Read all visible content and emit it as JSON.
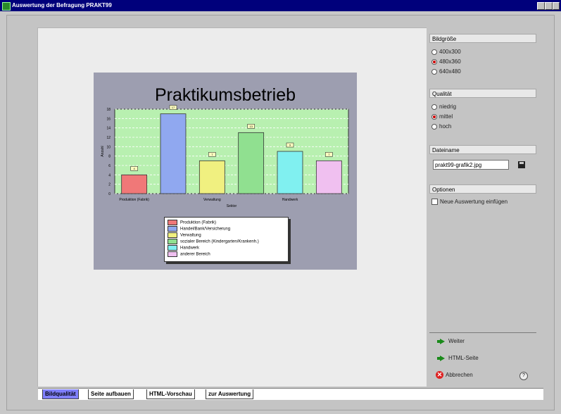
{
  "window": {
    "title": "Auswertung der Befragung   PRAKT99"
  },
  "chart": {
    "title": "Praktikumsbetrieb",
    "ylabel": "Anzahl",
    "xlabel": "Sektor",
    "xtick_labels": [
      "Produktion (Fabrik)",
      "Verwaltung",
      "Handwerk"
    ],
    "y_ticks": [
      "0",
      "2",
      "4",
      "6",
      "8",
      "10",
      "12",
      "14",
      "16",
      "18"
    ],
    "legend": [
      "Produktion (Fabrik)",
      "Handel/Bank/Versicherung",
      "Verwaltung",
      "sozialer Bereich (Kindergarten/Krankenh.)",
      "Handwerk",
      "anderer Bereich"
    ]
  },
  "chart_data": {
    "type": "bar",
    "title": "Praktikumsbetrieb",
    "categories": [
      "Produktion (Fabrik)",
      "Handel/Bank/Versicherung",
      "Verwaltung",
      "sozialer Bereich (Kindergarten/Krankenh.)",
      "Handwerk",
      "anderer Bereich"
    ],
    "values": [
      4,
      17,
      7,
      13,
      9,
      7
    ],
    "ylim": [
      0,
      18
    ],
    "grid": true,
    "legend_position": "bottom",
    "colors": [
      "#f07878",
      "#90a8f0",
      "#f0f080",
      "#90e090",
      "#80f0f0",
      "#f0c0f0"
    ]
  },
  "panel": {
    "size_section": {
      "header": "Bildgröße",
      "options": [
        "400x300",
        "480x360",
        "640x480"
      ],
      "selected": 1
    },
    "quality_section": {
      "header": "Qualität",
      "options": [
        "niedrig",
        "mittel",
        "hoch"
      ],
      "selected": 1
    },
    "filename_section": {
      "header": "Dateiname",
      "value": "prakt99-grafik2.jpg"
    },
    "options_section": {
      "header": "Optionen",
      "checkbox_label": "Neue Auswertung einfügen"
    },
    "actions": {
      "next": "Weiter",
      "html_page": "HTML-Seite",
      "cancel": "Abbrechen",
      "help": "?"
    }
  },
  "tabs": [
    "Bildqualität",
    "Seite aufbauen",
    "HTML-Vorschau",
    "zur Auswertung"
  ]
}
